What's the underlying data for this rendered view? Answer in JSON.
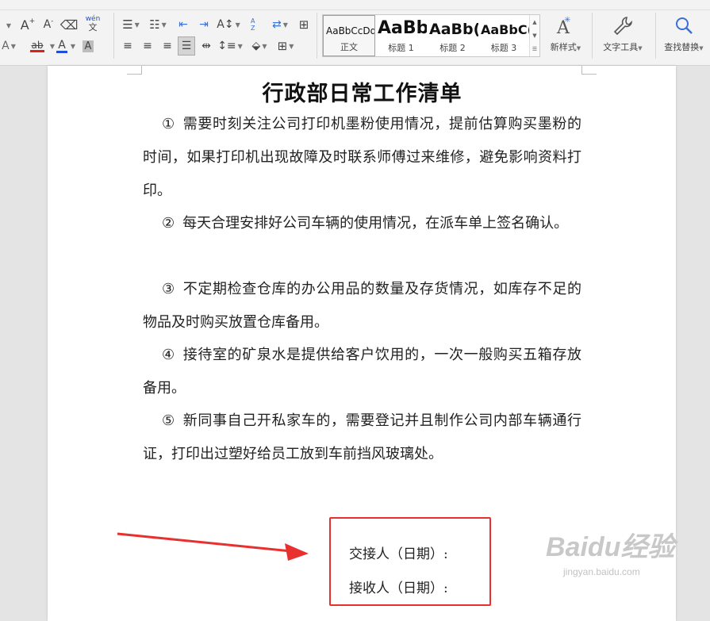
{
  "toolbar": {
    "grow_font": "A",
    "shrink_font": "A",
    "phonetic_guide": "wén",
    "highlight_letters": "ab",
    "font_color_letter": "A",
    "char_shading_letter": "A",
    "text_effects_letter": "A",
    "sort_letters": "AZ"
  },
  "styles": [
    {
      "sample": "AaBbCcDd",
      "name": "正文"
    },
    {
      "sample": "AaBb",
      "name": "标题 1"
    },
    {
      "sample": "AaBb(",
      "name": "标题 2"
    },
    {
      "sample": "AaBbC(",
      "name": "标题 3"
    }
  ],
  "actions": {
    "new_style": "新样式",
    "text_tools": "文字工具",
    "find_replace": "查找替换"
  },
  "document": {
    "title": "行政部日常工作清单",
    "paragraphs": [
      {
        "num": "①",
        "text": "需要时刻关注公司打印机墨粉使用情况，提前估算购买墨粉的时间，如果打印机出现故障及时联系师傅过来维修，避免影响资料打印。"
      },
      {
        "num": "②",
        "text": "每天合理安排好公司车辆的使用情况，在派车单上签名确认。"
      },
      {
        "num": "③",
        "text": "不定期检查仓库的办公用品的数量及存货情况，如库存不足的物品及时购买放置仓库备用。"
      },
      {
        "num": "④",
        "text": "接待室的矿泉水是提供给客户饮用的，一次一般购买五箱存放备用。"
      },
      {
        "num": "⑤",
        "text": "新同事自己开私家车的，需要登记并且制作公司内部车辆通行证，打印出过塑好给员工放到车前挡风玻璃处。"
      }
    ],
    "handover": "交接人（日期）:",
    "receiver": "接收人（日期）:"
  },
  "watermark": {
    "main": "Baidu经验",
    "sub": "jingyan.baidu.com"
  },
  "colors": {
    "annotation_red": "#e8312f",
    "highlight_red": "#e0201a",
    "font_color_blue": "#1f4ed8",
    "char_shading_gray": "#bdbdbd"
  }
}
